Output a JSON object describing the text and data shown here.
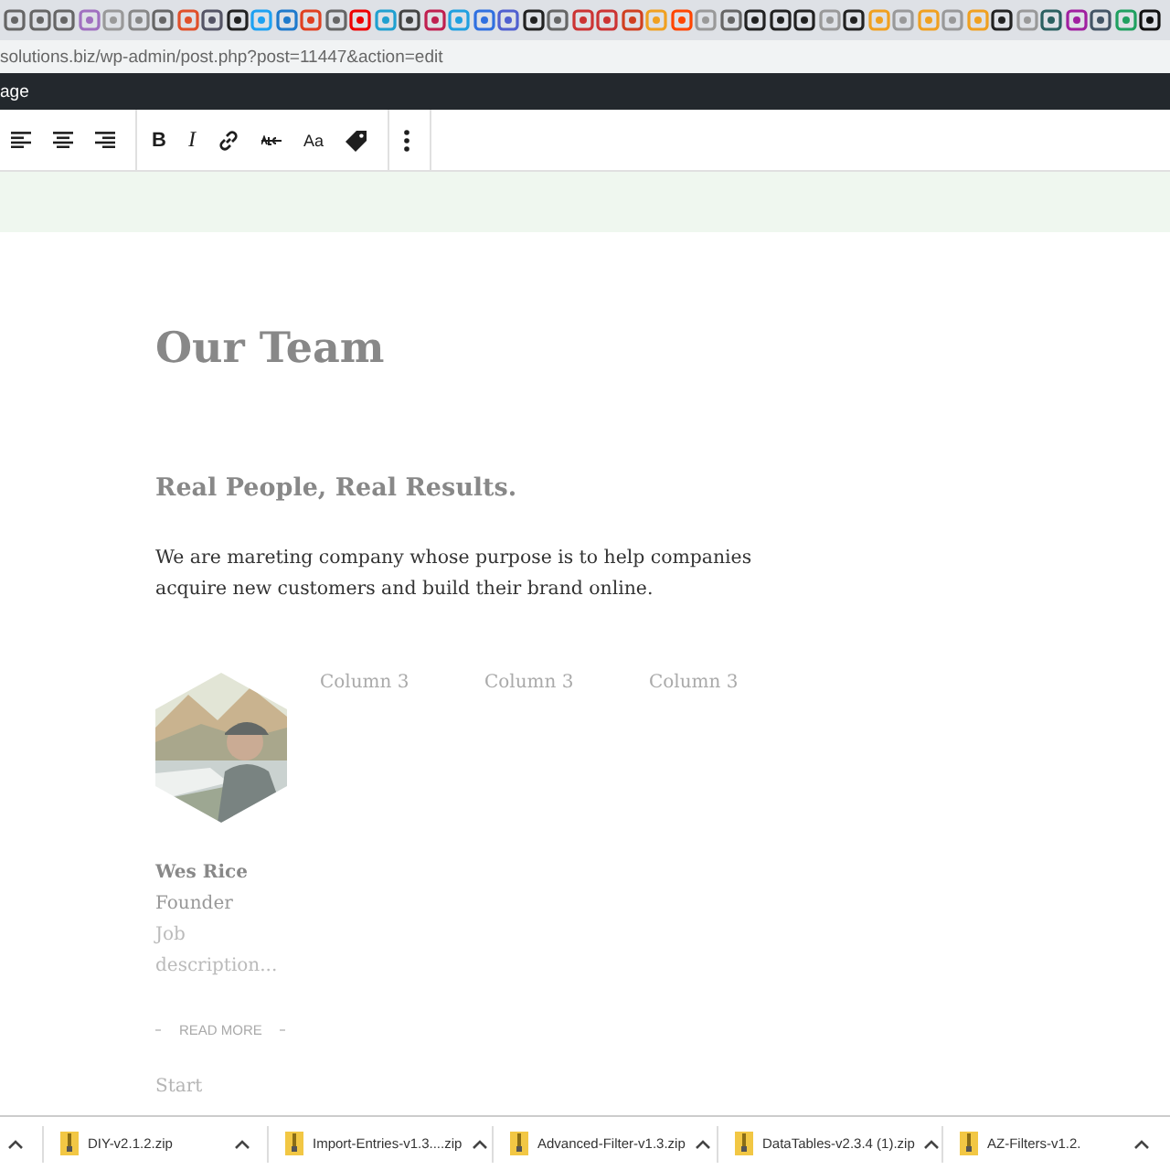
{
  "address_bar": {
    "url": "solutions.biz/wp-admin/post.php?post=11447&action=edit"
  },
  "admin_bar": {
    "title": "age"
  },
  "toolbar": {
    "groups": [
      [
        {
          "kind": "align-left"
        },
        {
          "kind": "align-center"
        },
        {
          "kind": "align-right"
        }
      ],
      [
        {
          "kind": "bold",
          "label": "B"
        },
        {
          "kind": "italic",
          "label": "I"
        },
        {
          "kind": "link"
        },
        {
          "kind": "strikethrough"
        },
        {
          "kind": "text",
          "label": "Aa"
        },
        {
          "kind": "tag"
        }
      ],
      [
        {
          "kind": "more"
        }
      ]
    ]
  },
  "content": {
    "title": "Our Team",
    "subtitle": "Real People, Real Results.",
    "paragraph": "We are mareting company whose purpose is to help companies acquire new customers and build their brand online.",
    "member": {
      "name": "Wes Rice",
      "role": "Founder",
      "description": [
        "Job",
        "description..."
      ],
      "read_more": "READ MORE"
    },
    "columns": [
      "Column 3",
      "Column 3",
      "Column 3"
    ],
    "placeholder": [
      "Start"
    ]
  },
  "downloads": [
    {
      "name": "DIY-v2.1.2.zip"
    },
    {
      "name": "Import-Entries-v1.3....zip"
    },
    {
      "name": "Advanced-Filter-v1.3.zip"
    },
    {
      "name": "DataTables-v2.3.4 (1).zip"
    },
    {
      "name": "AZ-Filters-v1.2."
    }
  ]
}
